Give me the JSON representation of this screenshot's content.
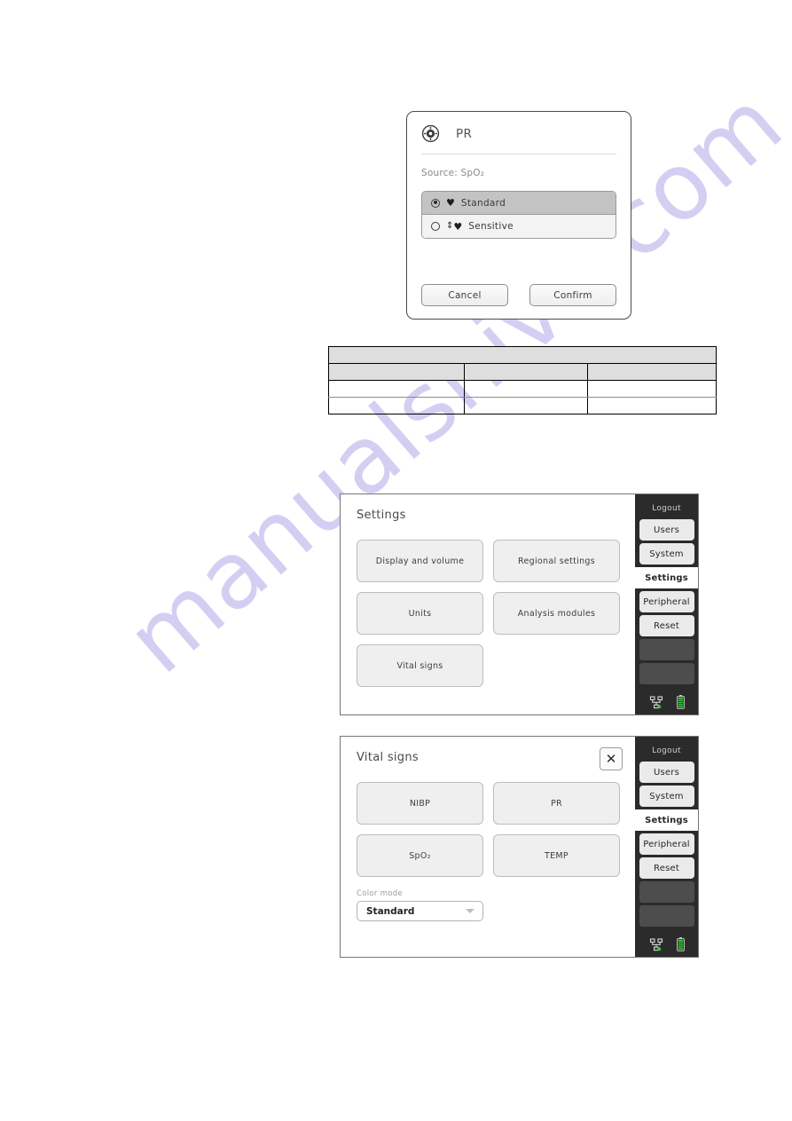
{
  "watermark": {
    "text": "manualshive.com",
    "color": "#b9b3ec"
  },
  "pr_dialog": {
    "icon": "gear-icon",
    "title": "PR",
    "source_label": "Source: SpO₂",
    "options": [
      {
        "label": "Standard",
        "glyph": "♥",
        "prefix": "",
        "selected": true
      },
      {
        "label": "Sensitive",
        "glyph": "♥",
        "prefix": "⇕",
        "selected": false
      }
    ],
    "cancel_label": "Cancel",
    "confirm_label": "Confirm"
  },
  "manual_table": {
    "rows": [
      {
        "cells": [
          ""
        ],
        "shaded": true,
        "merged": true
      },
      {
        "cells": [
          "",
          "",
          ""
        ],
        "shaded": true,
        "merged": false
      },
      {
        "cells": [
          "",
          "",
          ""
        ],
        "shaded": false,
        "merged": false
      },
      {
        "cells": [
          "",
          "",
          ""
        ],
        "shaded": false,
        "merged": false
      }
    ]
  },
  "settings_screen": {
    "title": "Settings",
    "tiles": [
      "Display and volume",
      "Regional settings",
      "Units",
      "Analysis modules",
      "Vital signs"
    ]
  },
  "vitals_screen": {
    "title": "Vital signs",
    "close_glyph": "✕",
    "tiles": [
      "NIBP",
      "PR",
      "SpO₂",
      "TEMP"
    ],
    "field_label": "Color mode",
    "field_value": "Standard"
  },
  "sidebar": {
    "logout_label": "Logout",
    "items": [
      {
        "label": "Users",
        "active": false
      },
      {
        "label": "System",
        "active": false
      },
      {
        "label": "Settings",
        "active": true
      },
      {
        "label": "Peripheral",
        "active": false
      },
      {
        "label": "Reset",
        "active": false
      }
    ],
    "empty_slots": 2,
    "status_icons": [
      "network-icon",
      "battery-icon"
    ],
    "status_color": "#36c636"
  }
}
